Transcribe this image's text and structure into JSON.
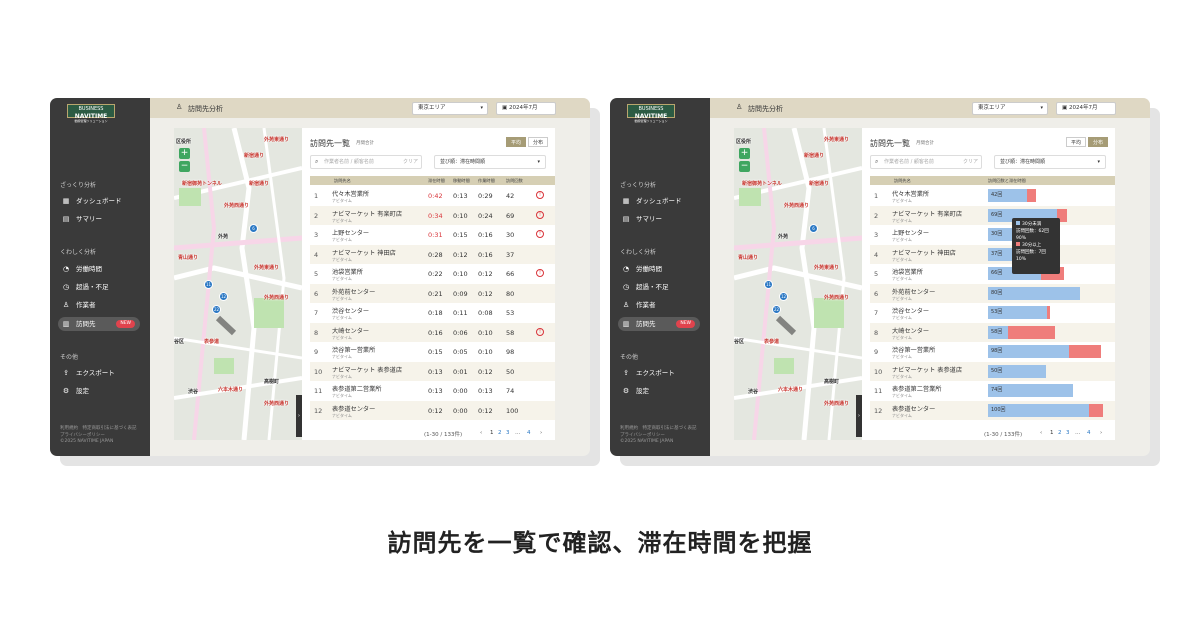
{
  "app": {
    "logo_line1": "BUSINESS",
    "logo_line2": "NAVITIME",
    "logo_line3": "動態管理ソリューション",
    "page_title": "訪問先分析",
    "area_select": "東京エリア",
    "month_select": "2024年7月"
  },
  "sidebar": {
    "section1": "ざっくり分析",
    "section2": "くわしく分析",
    "section3": "その他",
    "items": [
      {
        "label": "ダッシュボード",
        "icon": "dashboard-icon"
      },
      {
        "label": "サマリー",
        "icon": "summary-icon"
      },
      {
        "label": "労働時間",
        "icon": "stopwatch-icon"
      },
      {
        "label": "超過・不足",
        "icon": "clock-icon"
      },
      {
        "label": "作業者",
        "icon": "person-icon"
      },
      {
        "label": "訪問先",
        "icon": "building-icon"
      },
      {
        "label": "エクスポート",
        "icon": "export-icon"
      },
      {
        "label": "設定",
        "icon": "gear-icon"
      }
    ],
    "new_badge": "NEW",
    "footer1": "利用規約　特定商取引法に基づく表記",
    "footer2": "プライバシーポリシー",
    "footer3": "©2025 NAVITIME JAPAN"
  },
  "map": {
    "zoom_in": "+",
    "zoom_out": "−",
    "labels": [
      {
        "text": "区役所",
        "cls": "k"
      },
      {
        "text": "新宿通り",
        "cls": ""
      },
      {
        "text": "外苑東通り",
        "cls": ""
      },
      {
        "text": "新宿御苑トンネル",
        "cls": ""
      },
      {
        "text": "新宿通り",
        "cls": ""
      },
      {
        "text": "外苑西通り",
        "cls": ""
      },
      {
        "text": "外苑",
        "cls": "k"
      },
      {
        "text": "青山通り",
        "cls": ""
      },
      {
        "text": "外苑東通り",
        "cls": ""
      },
      {
        "text": "外苑西通り",
        "cls": ""
      },
      {
        "text": "谷区",
        "cls": "k"
      },
      {
        "text": "表参道",
        "cls": ""
      },
      {
        "text": "六本木通り",
        "cls": ""
      },
      {
        "text": "高樹町",
        "cls": "k"
      },
      {
        "text": "外苑西通り",
        "cls": ""
      },
      {
        "text": "渋谷",
        "cls": "k"
      }
    ],
    "pins": [
      "6",
      "11",
      "12",
      "22"
    ]
  },
  "list": {
    "title": "訪問先一覧",
    "subtitle": "月間合計",
    "toggle_avg": "平均",
    "toggle_dist": "分布",
    "search_placeholder": "作業者名前 / 顧客名前",
    "search_clear": "クリア",
    "sort_label": "並び順：滞在時間順",
    "columns": [
      "訪問先名",
      "滞在時間",
      "移動時間",
      "作業時間",
      "訪問回数"
    ],
    "dist_column": "訪問回数と滞在時間",
    "rows": [
      {
        "no": "1",
        "name": "代々木営業所",
        "sub": "ナビタイム",
        "stay": "0:42",
        "move": "0:13",
        "work": "0:29",
        "visits": "42",
        "warn": true,
        "red": true,
        "blue": 42,
        "red_part": 0.2
      },
      {
        "no": "2",
        "name": "ナビマーケット 有楽町店",
        "sub": "ナビタイム",
        "stay": "0:34",
        "move": "0:10",
        "work": "0:24",
        "visits": "69",
        "warn": true,
        "red": true,
        "blue": 69,
        "red_part": 0.13
      },
      {
        "no": "3",
        "name": "上野センター",
        "sub": "ナビタイム",
        "stay": "0:31",
        "move": "0:15",
        "work": "0:16",
        "visits": "30",
        "warn": true,
        "red": true,
        "blue": 30,
        "red_part": 0
      },
      {
        "no": "4",
        "name": "ナビマーケット 神田店",
        "sub": "ナビタイム",
        "stay": "0:28",
        "move": "0:12",
        "work": "0:16",
        "visits": "37",
        "warn": false,
        "red": false,
        "blue": 37,
        "red_part": 0.05
      },
      {
        "no": "5",
        "name": "池袋営業所",
        "sub": "ナビタイム",
        "stay": "0:22",
        "move": "0:10",
        "work": "0:12",
        "visits": "66",
        "warn": true,
        "red": false,
        "blue": 66,
        "red_part": 0.3
      },
      {
        "no": "6",
        "name": "外苑前センター",
        "sub": "ナビタイム",
        "stay": "0:21",
        "move": "0:09",
        "work": "0:12",
        "visits": "80",
        "warn": false,
        "red": false,
        "blue": 80,
        "red_part": 0
      },
      {
        "no": "7",
        "name": "渋谷センター",
        "sub": "ナビタイム",
        "stay": "0:18",
        "move": "0:11",
        "work": "0:08",
        "visits": "53",
        "warn": false,
        "red": false,
        "blue": 53,
        "red_part": 0.03
      },
      {
        "no": "8",
        "name": "大崎センター",
        "sub": "ナビタイム",
        "stay": "0:16",
        "move": "0:06",
        "work": "0:10",
        "visits": "58",
        "warn": true,
        "red": false,
        "blue": 58,
        "red_part": 0.7
      },
      {
        "no": "9",
        "name": "渋谷第一営業所",
        "sub": "ナビタイム",
        "stay": "0:15",
        "move": "0:05",
        "work": "0:10",
        "visits": "98",
        "warn": false,
        "red": false,
        "blue": 98,
        "red_part": 0.28
      },
      {
        "no": "10",
        "name": "ナビマーケット 表参道店",
        "sub": "ナビタイム",
        "stay": "0:13",
        "move": "0:01",
        "work": "0:12",
        "visits": "50",
        "warn": false,
        "red": false,
        "blue": 50,
        "red_part": 0
      },
      {
        "no": "11",
        "name": "表参道第二営業所",
        "sub": "ナビタイム",
        "stay": "0:13",
        "move": "0:00",
        "work": "0:13",
        "visits": "74",
        "warn": false,
        "red": false,
        "blue": 74,
        "red_part": 0
      },
      {
        "no": "12",
        "name": "表参道センター",
        "sub": "ナビタイム",
        "stay": "0:12",
        "move": "0:00",
        "work": "0:12",
        "visits": "100",
        "warn": false,
        "red": false,
        "blue": 100,
        "red_part": 0.12
      }
    ],
    "visit_suffix": "回",
    "pager_range": "(1-30 / 133件)",
    "pager_prev": "‹",
    "pager_pages": [
      "1",
      "2",
      "3",
      "…",
      "4"
    ],
    "pager_next": "›"
  },
  "tooltip": {
    "line1": "30分未満",
    "line2": "訪問回数：62回",
    "line3": "90%",
    "line4": "30分以上",
    "line5": "訪問回数：7回",
    "line6": "10%"
  },
  "caption": "訪問先を一覧で確認、滞在時間を把握",
  "colors": {
    "sidebar": "#3a3a3a",
    "topbar": "#dfd8c4",
    "accent": "#a69c76",
    "blue": "#9dc2e9",
    "red": "#ef7d7b",
    "warn": "#d9343a"
  }
}
